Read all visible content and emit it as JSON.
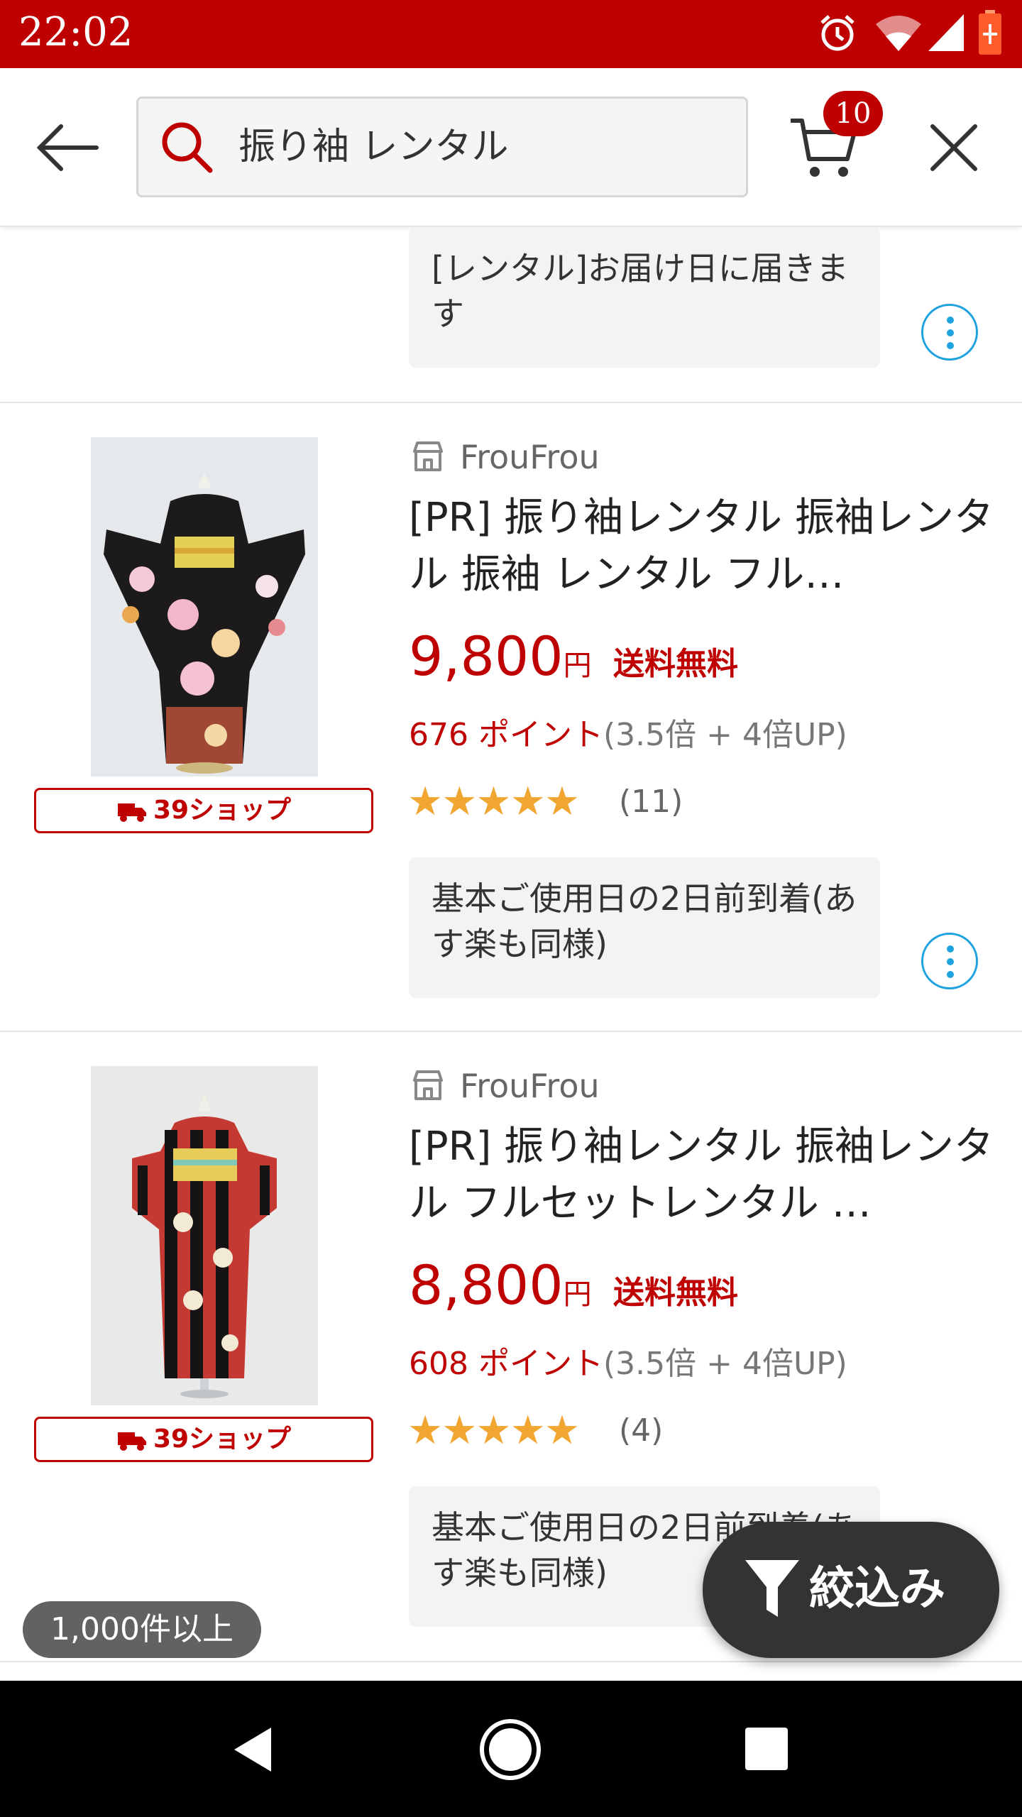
{
  "status_bar": {
    "time": "22:02"
  },
  "header": {
    "search_query": "振り袖 レンタル",
    "cart_count": "10"
  },
  "top_item": {
    "delivery_note": "[レンタル]お届け日に届きます"
  },
  "products": [
    {
      "shop": "FrouFrou",
      "title": "[PR] 振り袖レンタル 振袖レンタル 振袖 レンタル フル…",
      "price": "9,800",
      "yen": "円",
      "shipping": "送料無料",
      "points": "676 ポイント",
      "points_bonus": "(3.5倍 + 4倍UP)",
      "rating_stars": "★★★★★",
      "review_count": "(11)",
      "badge": "39ショップ",
      "delivery_note": "基本ご使用日の2日前到着(あす楽も同様)"
    },
    {
      "shop": "FrouFrou",
      "title": "[PR] 振り袖レンタル 振袖レンタル フルセットレンタル …",
      "price": "8,800",
      "yen": "円",
      "shipping": "送料無料",
      "points": "608 ポイント",
      "points_bonus": "(3.5倍 + 4倍UP)",
      "rating_stars": "★★★★★",
      "review_count": "(4)",
      "badge": "39ショップ",
      "delivery_note": "基本ご使用日の2日前到着(あす楽も同様)"
    }
  ],
  "result_count": "1,000件以上",
  "filter_button": {
    "label": "絞込み"
  },
  "colors": {
    "brand_red": "#bf0000",
    "star": "#f0a630",
    "kebab_blue": "#1fa2e0"
  }
}
